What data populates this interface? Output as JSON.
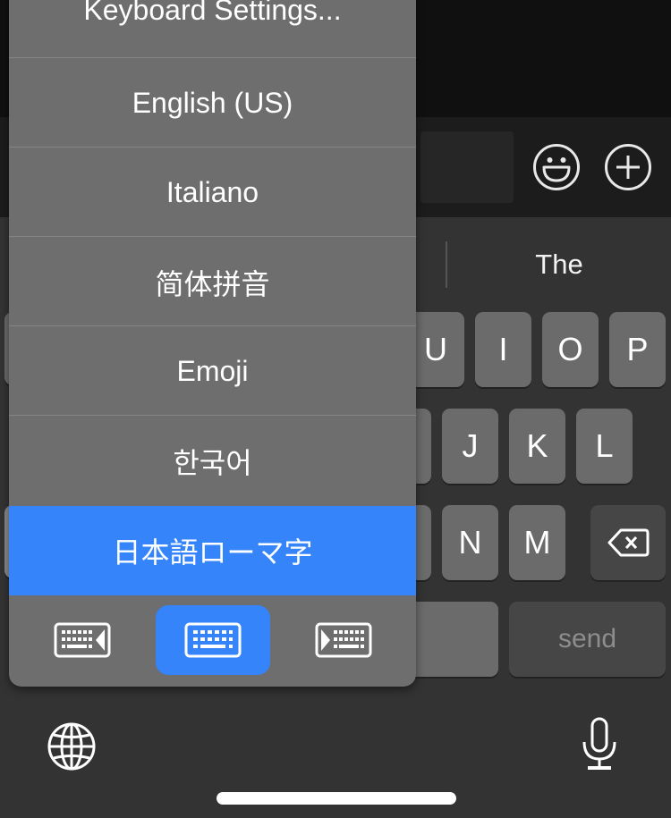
{
  "app": {
    "input_bar": {
      "emoji_button": "emoji-icon",
      "add_button": "plus-circle-icon"
    },
    "keyboard": {
      "suggestions": [
        "",
        "The"
      ],
      "rows": [
        [
          "U",
          "I",
          "O",
          "P"
        ],
        [
          "J",
          "K",
          "L"
        ],
        [
          "N",
          "M"
        ]
      ],
      "delete_key": "delete-icon",
      "send_label": "send",
      "globe_icon": "globe-icon",
      "mic_icon": "microphone-icon"
    },
    "language_menu": {
      "items": [
        {
          "label": "Keyboard Settings..."
        },
        {
          "label": "English (US)"
        },
        {
          "label": "Italiano"
        },
        {
          "label": "简体拼音"
        },
        {
          "label": "Emoji"
        },
        {
          "label": "한국어"
        },
        {
          "label": "日本語ローマ字",
          "selected": true
        }
      ],
      "layout_options": [
        {
          "name": "keyboard-left",
          "active": false
        },
        {
          "name": "keyboard-full",
          "active": true
        },
        {
          "name": "keyboard-right",
          "active": false
        }
      ],
      "accent_color": "#3584fa"
    }
  }
}
